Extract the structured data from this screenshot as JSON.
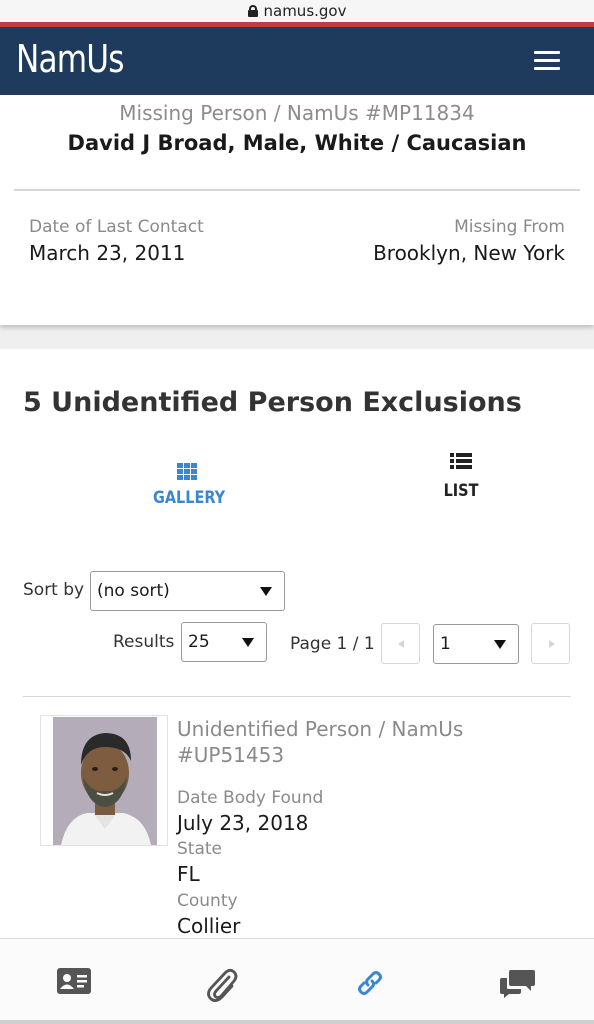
{
  "browser": {
    "url": "namus.gov"
  },
  "header": {
    "logo": "NamUs"
  },
  "case": {
    "subtitle": "Missing Person / NamUs #MP11834",
    "name": "David J Broad, Male, White / Caucasian",
    "last_contact_label": "Date of Last Contact",
    "last_contact_value": "March 23, 2011",
    "missing_from_label": "Missing From",
    "missing_from_value": "Brooklyn, New York"
  },
  "exclusions": {
    "title": "5 Unidentified Person Exclusions",
    "tabs": {
      "gallery": "GALLERY",
      "list": "LIST"
    },
    "sort_label": "Sort by",
    "sort_value": "(no sort)",
    "results_label": "Results",
    "results_value": "25",
    "page_label": "Page 1 / 1",
    "page_value": "1",
    "results": [
      {
        "title": "Unidentified Person / NamUs #UP51453",
        "date_label": "Date Body Found",
        "date_value": "July 23, 2018",
        "state_label": "State",
        "state_value": "FL",
        "county_label": "County",
        "county_value": "Collier"
      }
    ]
  },
  "colors": {
    "header_bg": "#1e3a5c",
    "accent_red": "#c63a44",
    "active_tab": "#3a87cf",
    "link_icon": "#3a87cf"
  },
  "icons": {
    "bottom_nav": [
      "id-card-icon",
      "paperclip-icon",
      "link-icon",
      "chat-bubbles-icon"
    ]
  }
}
